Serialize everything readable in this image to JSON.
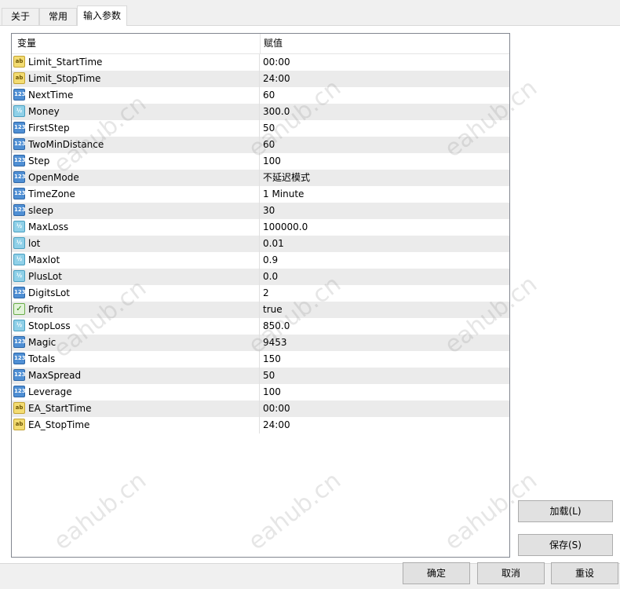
{
  "tabs": [
    {
      "label": "关于"
    },
    {
      "label": "常用"
    },
    {
      "label": "输入参数"
    }
  ],
  "table": {
    "headers": [
      "变量",
      "赋值"
    ],
    "rows": [
      {
        "icon": "string",
        "name": "Limit_StartTime",
        "value": "00:00"
      },
      {
        "icon": "string",
        "name": "Limit_StopTime",
        "value": "24:00"
      },
      {
        "icon": "integer",
        "name": "NextTime",
        "value": "60"
      },
      {
        "icon": "double",
        "name": "Money",
        "value": "300.0"
      },
      {
        "icon": "integer",
        "name": "FirstStep",
        "value": "50"
      },
      {
        "icon": "integer",
        "name": "TwoMinDistance",
        "value": "60"
      },
      {
        "icon": "integer",
        "name": "Step",
        "value": "100"
      },
      {
        "icon": "integer",
        "name": "OpenMode",
        "value": "不延迟模式"
      },
      {
        "icon": "integer",
        "name": "TimeZone",
        "value": "1 Minute"
      },
      {
        "icon": "integer",
        "name": "sleep",
        "value": "30"
      },
      {
        "icon": "double",
        "name": "MaxLoss",
        "value": "100000.0"
      },
      {
        "icon": "double",
        "name": "lot",
        "value": "0.01"
      },
      {
        "icon": "double",
        "name": "Maxlot",
        "value": "0.9"
      },
      {
        "icon": "double",
        "name": "PlusLot",
        "value": "0.0"
      },
      {
        "icon": "integer",
        "name": "DigitsLot",
        "value": "2"
      },
      {
        "icon": "bool",
        "name": "Profit",
        "value": "true"
      },
      {
        "icon": "double",
        "name": "StopLoss",
        "value": "850.0"
      },
      {
        "icon": "integer",
        "name": "Magic",
        "value": "9453"
      },
      {
        "icon": "integer",
        "name": "Totals",
        "value": "150"
      },
      {
        "icon": "integer",
        "name": "MaxSpread",
        "value": "50"
      },
      {
        "icon": "integer",
        "name": "Leverage",
        "value": "100"
      },
      {
        "icon": "string",
        "name": "EA_StartTime",
        "value": "00:00"
      },
      {
        "icon": "string",
        "name": "EA_StopTime",
        "value": "24:00"
      }
    ]
  },
  "side_buttons": {
    "load": "加载(L)",
    "save": "保存(S)"
  },
  "footer_buttons": {
    "ok": "确定",
    "cancel": "取消",
    "reset": "重设"
  },
  "watermark": "eahub.cn"
}
